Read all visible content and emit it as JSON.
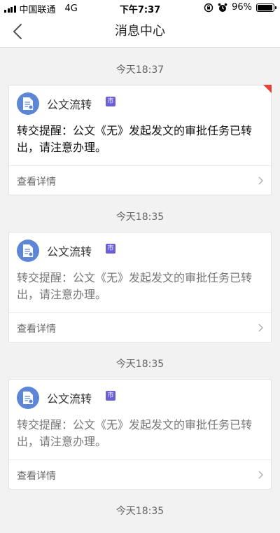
{
  "status_bar": {
    "carrier": "中国联通",
    "network": "4G",
    "time": "下午7:37",
    "battery": "96%",
    "battery_level": 0.96
  },
  "nav": {
    "title": "消息中心",
    "back_icon": "chevron-left-icon"
  },
  "messages": [
    {
      "time": "今天18:37",
      "app_name": "公文流转",
      "badge": "市",
      "text": "转交提醒：公文《无》发起发文的审批任务已转出，请注意办理。",
      "detail_label": "查看详情",
      "unread": true
    },
    {
      "time": "今天18:35",
      "app_name": "公文流转",
      "badge": "市",
      "text": "转交提醒：公文《无》发起发文的审批任务已转出，请注意办理。",
      "detail_label": "查看详情",
      "unread": false
    },
    {
      "time": "今天18:35",
      "app_name": "公文流转",
      "badge": "市",
      "text": "转交提醒：公文《无》发起发文的审批任务已转出，请注意办理。",
      "detail_label": "查看详情",
      "unread": false
    },
    {
      "time": "今天18:35"
    }
  ],
  "colors": {
    "accent_icon": "#5e86d6",
    "badge": "#6b5fd6",
    "unread_flag": "#e8413a"
  }
}
